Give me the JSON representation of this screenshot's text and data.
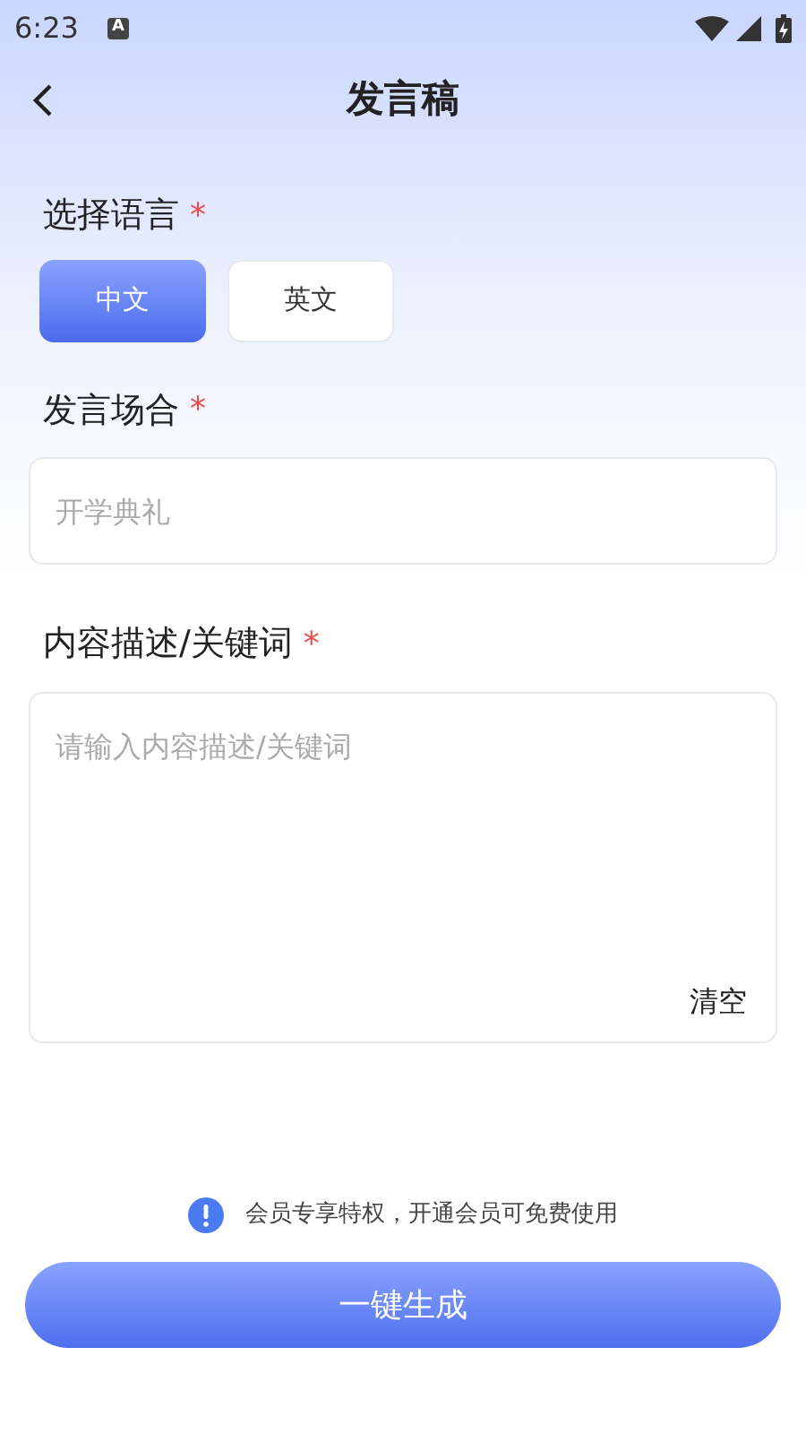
{
  "status_bar": {
    "time": "6:23",
    "notification": "A"
  },
  "header": {
    "title": "发言稿"
  },
  "language": {
    "label": "选择语言",
    "required_mark": "*",
    "options": [
      {
        "label": "中文",
        "selected": true
      },
      {
        "label": "英文",
        "selected": false
      }
    ]
  },
  "occasion": {
    "label": "发言场合",
    "required_mark": "*",
    "placeholder": "开学典礼"
  },
  "description": {
    "label": "内容描述/关键词",
    "required_mark": "*",
    "placeholder": "请输入内容描述/关键词",
    "clear": "清空"
  },
  "notice": "会员专享特权，开通会员可免费使用",
  "generate_button": "一键生成"
}
